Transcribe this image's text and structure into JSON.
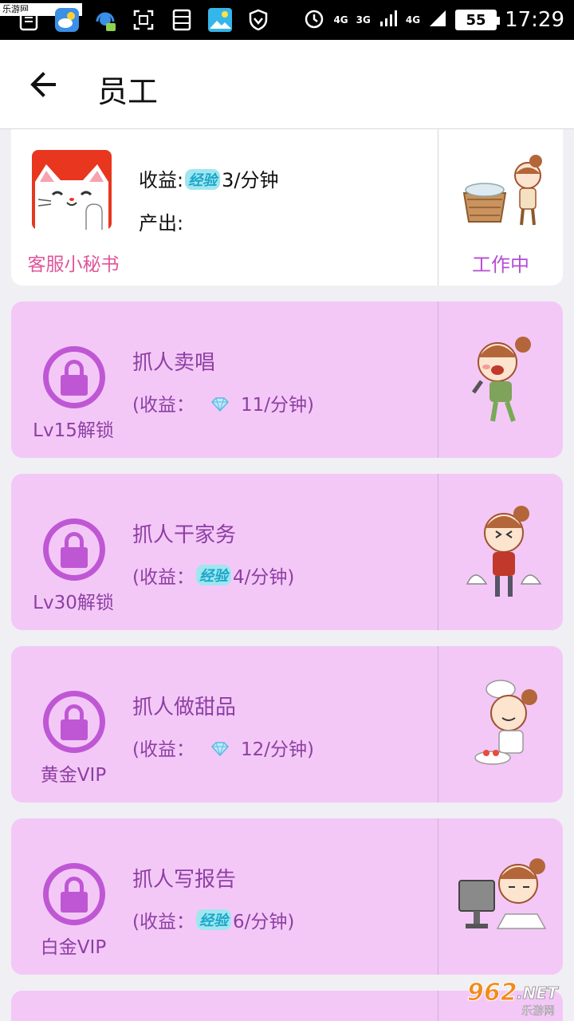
{
  "status_bar": {
    "watermark": "乐游网 www.962.net",
    "network_1": "4G",
    "network_2": "3G",
    "network_3": "4G",
    "battery": "55",
    "time": "17:29"
  },
  "app_bar": {
    "title": "员工"
  },
  "secretary": {
    "name": "客服小秘书",
    "income_label": "收益:",
    "income_exp_badge": "经验",
    "income_value": "3/分钟",
    "output_label": "产出:",
    "status": "工作中"
  },
  "jobs": [
    {
      "title": "抓人卖唱",
      "income_prefix": "(收益：",
      "currency": "diamond",
      "income_value": "11/分钟)",
      "unlock": "Lv15解锁"
    },
    {
      "title": "抓人干家务",
      "income_prefix": "(收益：",
      "currency": "exp",
      "exp_badge": "经验",
      "income_value": "4/分钟)",
      "unlock": "Lv30解锁"
    },
    {
      "title": "抓人做甜品",
      "income_prefix": "(收益：",
      "currency": "diamond",
      "income_value": "12/分钟)",
      "unlock": "黄金VIP"
    },
    {
      "title": "抓人写报告",
      "income_prefix": "(收益：",
      "currency": "exp",
      "exp_badge": "经验",
      "income_value": "6/分钟)",
      "unlock": "白金VIP"
    }
  ],
  "bottom_watermark": {
    "brand": "962.NET",
    "sub": "乐游网"
  },
  "colors": {
    "locked_card_bg": "#f3c8f7",
    "lock_accent": "#bf57d5",
    "text_purple": "#8e3fa3",
    "secretary_name": "#e0559c",
    "status_working": "#b64cd4"
  }
}
